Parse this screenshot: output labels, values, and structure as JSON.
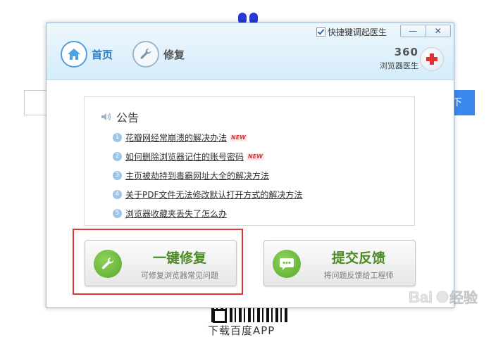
{
  "background": {
    "search_button_partial": "下",
    "download_text": "下载百度APP"
  },
  "dialog": {
    "hotkey_label": "快捷键调起医生",
    "hotkey_checked": true,
    "minimize_symbol": "—",
    "close_symbol": "✕",
    "nav": [
      {
        "label": "首页",
        "icon": "home-icon",
        "active": true
      },
      {
        "label": "修复",
        "icon": "wrench-icon",
        "active": false
      }
    ],
    "brand": {
      "number": "360",
      "name": "浏览器医生",
      "icon": "first-aid-cross-icon"
    },
    "notice": {
      "title": "公告",
      "icon": "speaker-icon",
      "items": [
        {
          "num": "1",
          "text": "花瓣网经常崩溃的解决办法",
          "new": "NEW"
        },
        {
          "num": "2",
          "text": "如何删除浏览器记住的账号密码",
          "new": "NEW"
        },
        {
          "num": "3",
          "text": "主页被劫持到毒霸网址大全的解决方法",
          "new": ""
        },
        {
          "num": "4",
          "text": "关于PDF文件无法修改默认打开方式的解决方法",
          "new": ""
        },
        {
          "num": "5",
          "text": "浏览器收藏夹丢失了怎么办",
          "new": ""
        }
      ]
    },
    "actions": {
      "repair": {
        "title": "一键修复",
        "subtitle": "可修复浏览器常见问题",
        "icon": "wrench-icon"
      },
      "feedback": {
        "title": "提交反馈",
        "subtitle": "将问题反馈给工程师",
        "icon": "chat-bubble-icon"
      }
    }
  },
  "colors": {
    "accent_blue": "#2f7fc6",
    "action_green": "#4b8a24",
    "highlight_red": "#e23535",
    "new_tag_red": "#e8333a"
  },
  "watermark": "Baidu经验"
}
